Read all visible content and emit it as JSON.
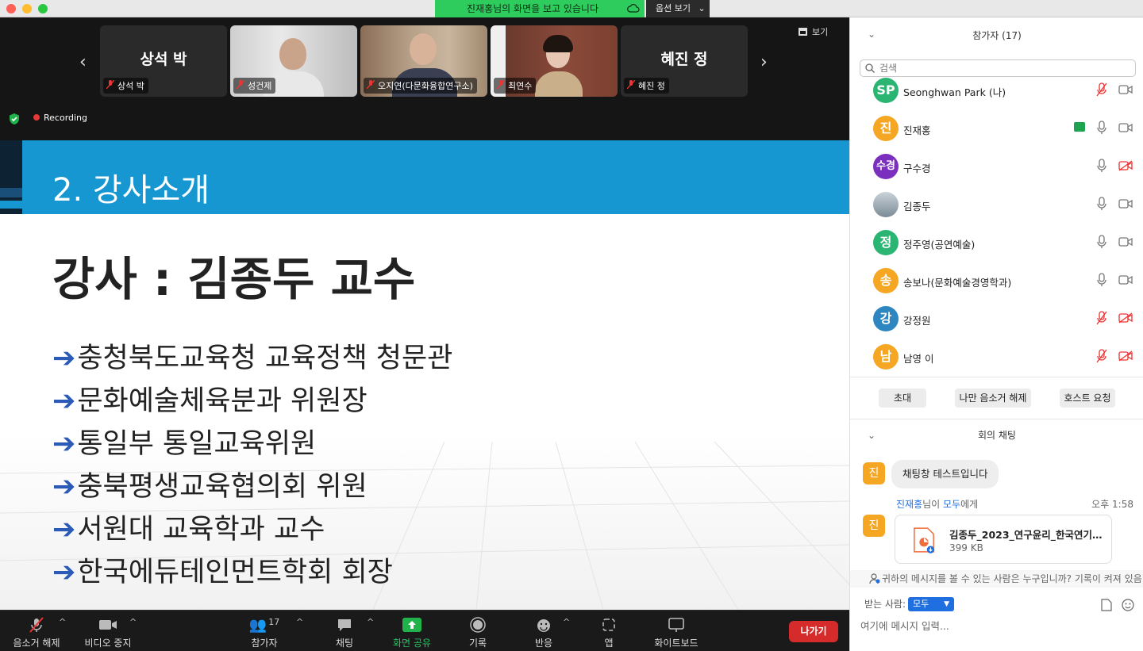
{
  "window": {
    "share_banner": "진재홍님의 화면을 보고 있습니다",
    "view_options": "옵션 보기"
  },
  "gallery": {
    "view_label": "보기",
    "tiles": [
      {
        "big_name": "상석 박",
        "label": "상석 박"
      },
      {
        "big_name": "",
        "label": "성건제"
      },
      {
        "big_name": "",
        "label": "오지연(다문화융합연구소)"
      },
      {
        "big_name": "",
        "label": "최연수"
      },
      {
        "big_name": "혜진 정",
        "label": "혜진 정"
      }
    ],
    "recording": "Recording"
  },
  "slide": {
    "title": "2. 강사소개",
    "heading": "강사 : 김종두 교수",
    "bullets": [
      "충청북도교육청 교육정책 청문관",
      "문화예술체육분과 위원장",
      "통일부 통일교육위원",
      "충북평생교육협의회 위원",
      "서원대 교육학과 교수",
      "한국에듀테인먼트학회 회장"
    ],
    "arrow": "➔"
  },
  "toolbar": {
    "mute": "음소거 해제",
    "video": "비디오 중지",
    "participants": "참가자",
    "participants_count": "17",
    "chat": "채팅",
    "share": "화면 공유",
    "record": "기록",
    "react": "반응",
    "apps": "앱",
    "whiteboard": "화이트보드",
    "leave": "나가기"
  },
  "participants": {
    "title": "참가자 (17)",
    "search_placeholder": "검색",
    "list": [
      {
        "initials": "SP",
        "name": "Seonghwan Park (나)",
        "color": "#2bb573"
      },
      {
        "initials": "진",
        "name": "진재홍",
        "color": "#f5a623"
      },
      {
        "initials": "수경",
        "name": "구수경",
        "color": "#7b2fbe"
      },
      {
        "initials": "",
        "name": "김종두",
        "color": "#9aa7b2"
      },
      {
        "initials": "정",
        "name": "정주영(공연예술)",
        "color": "#2bb573"
      },
      {
        "initials": "송",
        "name": "송보나(문화예술경영학과)",
        "color": "#f5a623"
      },
      {
        "initials": "강",
        "name": "강정원",
        "color": "#2e86c1"
      },
      {
        "initials": "남",
        "name": "남영 이",
        "color": "#f5a623"
      }
    ],
    "invite": "초대",
    "unmute_me": "나만 음소거 해제",
    "host_request": "호스트 요청"
  },
  "chat": {
    "title": "회의 채팅",
    "sender_initial": "진",
    "message1": "채팅창 테스트입니다",
    "meta_sender": "진재홍",
    "meta_mid": "님이 ",
    "meta_target": "모두",
    "meta_end": "에게",
    "meta_time": "오후 1:58",
    "file_name": "김종두_2023_연구윤리_한국연기…",
    "file_size": "399 KB",
    "notice": "귀하의 메시지를 볼 수 있는 사람은 누구입니까? 기록이 켜져 있음",
    "to_label": "받는 사람:",
    "to_value": "모두",
    "input_placeholder": "여기에 메시지 입력..."
  }
}
